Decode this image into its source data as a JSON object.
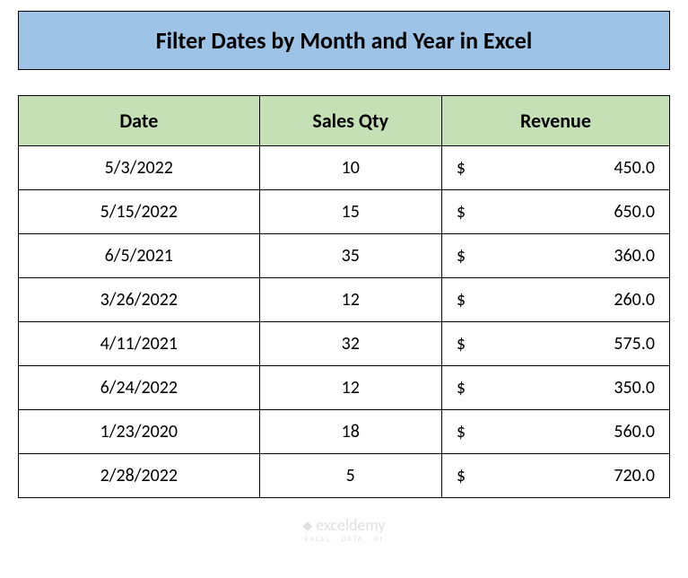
{
  "title": "Filter Dates by Month and Year in Excel",
  "columns": {
    "date": "Date",
    "qty": "Sales Qty",
    "revenue": "Revenue"
  },
  "currency_symbol": "$",
  "rows": [
    {
      "date": "5/3/2022",
      "qty": "10",
      "revenue": "450.0"
    },
    {
      "date": "5/15/2022",
      "qty": "15",
      "revenue": "650.0"
    },
    {
      "date": "6/5/2021",
      "qty": "35",
      "revenue": "360.0"
    },
    {
      "date": "3/26/2022",
      "qty": "12",
      "revenue": "260.0"
    },
    {
      "date": "4/11/2021",
      "qty": "32",
      "revenue": "575.0"
    },
    {
      "date": "6/24/2022",
      "qty": "12",
      "revenue": "350.0"
    },
    {
      "date": "1/23/2020",
      "qty": "18",
      "revenue": "560.0"
    },
    {
      "date": "2/28/2022",
      "qty": "5",
      "revenue": "720.0"
    }
  ],
  "watermark": {
    "main": "exceldemy",
    "sub": "EXCEL · DATA · BI"
  }
}
